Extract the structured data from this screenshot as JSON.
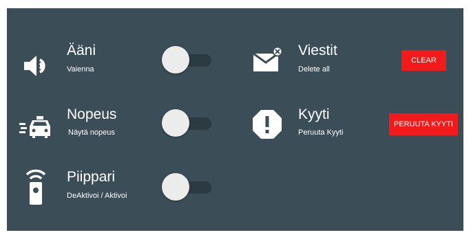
{
  "settings": {
    "sound": {
      "title": "Ääni",
      "subtitle": "Vaienna",
      "enabled": false,
      "icon": "speaker-icon"
    },
    "speed": {
      "title": "Nopeus",
      "subtitle": "Näytä nopeus",
      "enabled": false,
      "icon": "taxi-icon"
    },
    "beeper": {
      "title": "Piippari",
      "subtitle": "DeAktivoi / Aktivoi",
      "enabled": false,
      "icon": "beeper-icon"
    },
    "messages": {
      "title": "Viestit",
      "subtitle": "Delete all",
      "button_label": "CLEAR",
      "icon": "mail-icon"
    },
    "ride": {
      "title": "Kyyti",
      "subtitle": "Peruuta Kyyti",
      "button_label": "PERUUTA KYYTI",
      "icon": "alert-octagon-icon"
    }
  },
  "colors": {
    "background": "#3b4d57",
    "text": "#ffffff",
    "button": "#f21a1a",
    "toggle_thumb": "#ececec",
    "toggle_track": "#2c3a42"
  }
}
